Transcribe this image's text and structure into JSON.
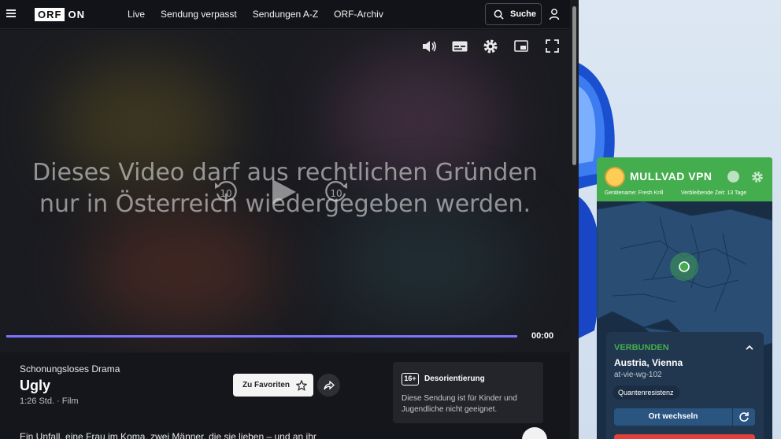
{
  "orf": {
    "logo_box": "ORF",
    "logo_on": "ON",
    "nav": [
      "Live",
      "Sendung verpasst",
      "Sendungen A-Z",
      "ORF-Archiv"
    ],
    "search_label": "Suche"
  },
  "video": {
    "blocked_line1": "Dieses Video darf aus rechtlichen Gründen",
    "blocked_line2": "nur in Österreich wiedergegeben werden.",
    "rewind_label": "10",
    "forward_label": "10",
    "timecode": "00:00",
    "progress": 1.0
  },
  "info": {
    "genre": "Schonungsloses Drama",
    "title": "Ugly",
    "meta": "1:26 Std. · Film",
    "favorites_label": "Zu Favoriten",
    "age_rating": "16+",
    "warning_title": "Desorientierung",
    "warning_text": "Diese Sendung ist für Kinder und Jugendliche nicht geeignet.",
    "description": "Ein Unfall, eine Frau im Koma, zwei Männer, die sie lieben – und an ihr"
  },
  "mullvad": {
    "app_name": "MULLVAD VPN",
    "device_name": "Gerätename: Fresh Krill",
    "remaining_time": "Verbleibende Zeit: 13 Tage",
    "status": "VERBUNDEN",
    "location": "Austria, Vienna",
    "server": "at-vie-wg-102",
    "quantum_tag": "Quantenresistenz",
    "switch_location_label": "Ort wechseln",
    "accent_green": "#44ad4d",
    "disconnect_red": "#e34039"
  },
  "icons": [
    "menu-icon",
    "search-icon",
    "user-icon",
    "volume-icon",
    "subtitles-icon",
    "settings-icon",
    "picture-in-picture-icon",
    "fullscreen-icon",
    "rewind-icon",
    "play-icon",
    "forward-icon",
    "star-icon",
    "share-icon",
    "account-icon",
    "gear-icon",
    "chevron-up-icon",
    "reconnect-icon"
  ]
}
